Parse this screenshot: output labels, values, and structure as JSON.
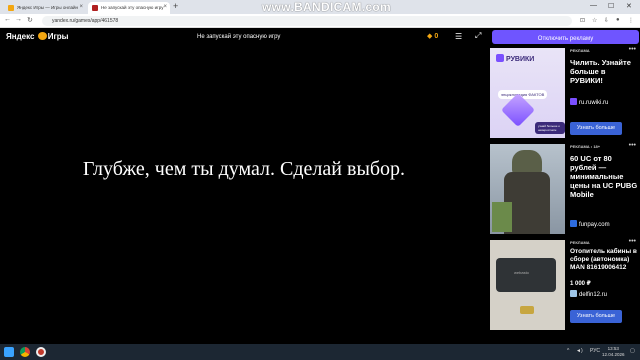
{
  "browser": {
    "tabs": [
      {
        "label": "Яндекс Игры — Игры онлайн"
      },
      {
        "label": "Не запускай эту опасную игру"
      }
    ],
    "new_tab": "+",
    "url": "yandex.ru/games/app/461578",
    "watermark": "www.BANDICAM.com"
  },
  "site": {
    "logo_text_1": "Яндекс",
    "logo_text_2": "Игры",
    "game_title": "Не запускай эту опасную игру",
    "coins": "0",
    "disable_ads": "Отключить рекламу"
  },
  "game": {
    "text": "Глубже, чем ты думал. Сделай выбор."
  },
  "ads": [
    {
      "label": "РЕКЛАМА",
      "title": "Чилить. Узнайте больше в РУВИКИ!",
      "domain": "ru.ruwiki.ru",
      "cta": "Узнать больше",
      "brand": "РУВИКИ",
      "image_caption": "энциклопедия ФАКТОВ",
      "image_pill": "узнай больше о невероятном"
    },
    {
      "label": "РЕКЛАМА • 18+",
      "title": "60 UC от 80 рублей — минимальные цены на UC PUBG Mobile",
      "domain": "funpay.com"
    },
    {
      "label": "РЕКЛАМА",
      "title": "Отопитель кабины в сборе (автономка) MAN 81619006412",
      "price": "1 000 ₽",
      "domain": "delfin12.ru",
      "cta": "Узнать больше",
      "image_caption": "webasto"
    }
  ],
  "taskbar": {
    "lang": "РУС",
    "time": "13:53",
    "date": "12.04.2026"
  },
  "colors": {
    "accent": "#6f55ff",
    "cta": "#3a63d6",
    "coin": "#f3a712"
  }
}
